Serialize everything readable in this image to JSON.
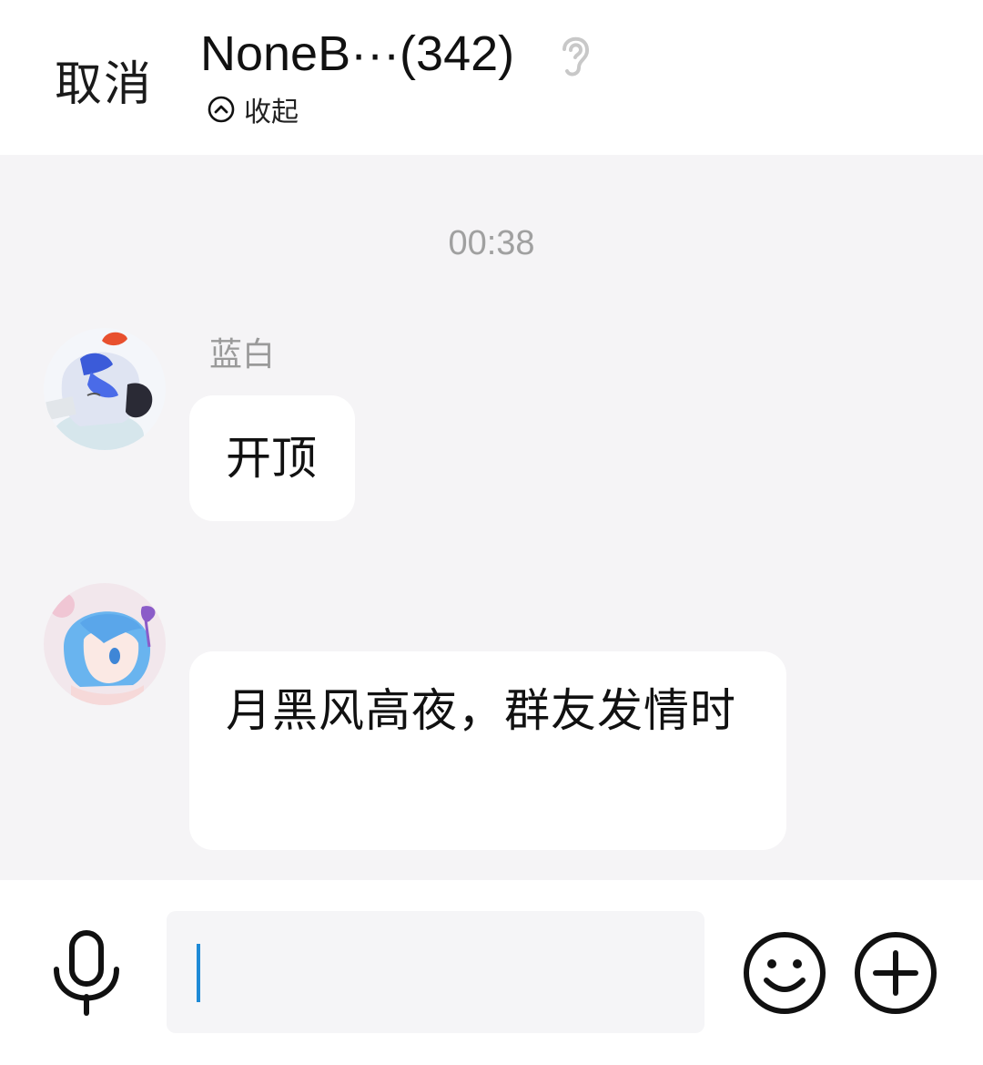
{
  "header": {
    "cancel_label": "取消",
    "title": "NoneB···(342)",
    "collapse_label": "收起",
    "icons": [
      "ear-icon",
      "chevron-up-circle-icon"
    ]
  },
  "chat": {
    "timestamp": "00:38",
    "messages": [
      {
        "sender": "蓝白",
        "text": "开顶",
        "avatar": "anime-avatar-white-hair"
      },
      {
        "sender": "",
        "text": "月黑风高夜，群友发情时",
        "avatar": "anime-avatar-blue-hair"
      }
    ]
  },
  "input_bar": {
    "value": "",
    "icons": [
      "microphone-icon",
      "emoji-icon",
      "plus-icon"
    ],
    "caret_color": "#1e8ad6"
  },
  "colors": {
    "chat_background": "#f5f4f6",
    "bubble": "#ffffff",
    "muted_text": "#9a9a9a"
  }
}
